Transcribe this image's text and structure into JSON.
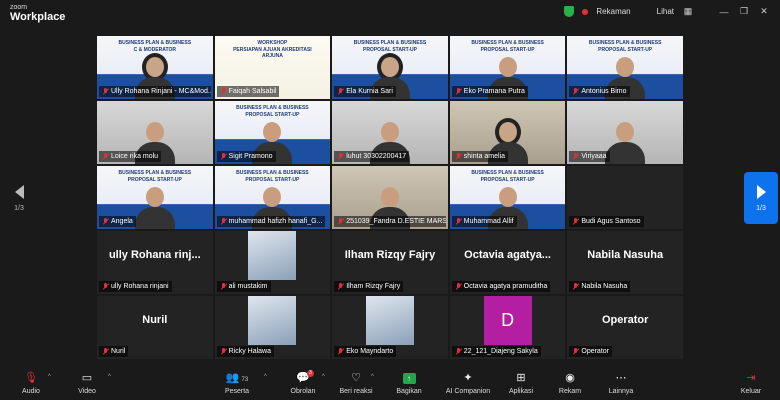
{
  "app": {
    "brand_small": "zoom",
    "brand": "Workplace"
  },
  "titlebar": {
    "recording": "Rekaman",
    "view": "Lihat"
  },
  "nav": {
    "page_left": "1/3",
    "page_right": "1/3"
  },
  "rows": [
    [
      {
        "name": "Ully Rohana Rinjani - MC&Mod...",
        "bg": "slide",
        "kind": "hijab",
        "slide_text": "BUSINESS PLAN & BUSINESS\nC & MODERATOR",
        "active": true
      },
      {
        "name": "Faiqah Salsabil",
        "bg": "slide2",
        "kind": "none",
        "slide_text": "WORKSHOP\nPERSIAPAN AJUAN AKREDITASI\nARJUNA"
      },
      {
        "name": "Ela Kurnia Sari",
        "bg": "slide",
        "kind": "hijab",
        "slide_text": "BUSINESS PLAN & BUSINESS\nPROPOSAL START-UP"
      },
      {
        "name": "Eko Pramana Putra",
        "bg": "slide",
        "kind": "person",
        "slide_text": "BUSINESS PLAN & BUSINESS\nPROPOSAL START-UP"
      },
      {
        "name": "Antonius Bimo",
        "bg": "slide",
        "kind": "person",
        "slide_text": "BUSINESS PLAN & BUSINESS\nPROPOSAL START-UP"
      }
    ],
    [
      {
        "name": "Loice rika molu",
        "bg": "room2",
        "kind": "person"
      },
      {
        "name": "Sigit Pramono",
        "bg": "slide",
        "kind": "person",
        "slide_text": "BUSINESS PLAN & BUSINESS\nPROPOSAL START-UP"
      },
      {
        "name": "luhut 30302200417",
        "bg": "room2",
        "kind": "person"
      },
      {
        "name": "shinta amelia",
        "bg": "room",
        "kind": "hijab"
      },
      {
        "name": "Viriyaaa",
        "bg": "room2",
        "kind": "person"
      }
    ],
    [
      {
        "name": "Angela",
        "bg": "slide",
        "kind": "person",
        "slide_text": "BUSINESS PLAN & BUSINESS\nPROPOSAL START-UP"
      },
      {
        "name": "muhammad hafizh hanafi_G...",
        "bg": "slide",
        "kind": "person",
        "slide_text": "BUSINESS PLAN & BUSINESS\nPROPOSAL START-UP"
      },
      {
        "name": "251039_Fandra D.ESTIE MARS",
        "bg": "room",
        "kind": "person"
      },
      {
        "name": "Muhammad Allif",
        "bg": "slide",
        "kind": "person",
        "slide_text": "BUSINESS PLAN & BUSINESS\nPROPOSAL START-UP"
      },
      {
        "name": "Budi Agus Santoso",
        "bg": "dark",
        "kind": "none"
      }
    ],
    [
      {
        "name": "ully Rohana rinjani",
        "bg": "dark",
        "kind": "text",
        "big": "ully Rohana rinj..."
      },
      {
        "name": "ali mustakim",
        "bg": "dark",
        "kind": "thumb"
      },
      {
        "name": "Ilham Rizqy Fajry",
        "bg": "dark",
        "kind": "text",
        "big": "Ilham Rizqy Fajry"
      },
      {
        "name": "Octavia agatya pramuditha",
        "bg": "dark",
        "kind": "text",
        "big": "Octavia agatya..."
      },
      {
        "name": "Nabila Nasuha",
        "bg": "dark",
        "kind": "text",
        "big": "Nabila Nasuha"
      }
    ],
    [
      {
        "name": "Nuril",
        "bg": "dark",
        "kind": "text",
        "big": "Nuril"
      },
      {
        "name": "Ricky Halawa",
        "bg": "dark",
        "kind": "thumb"
      },
      {
        "name": "Eko Mayndarto",
        "bg": "dark",
        "kind": "thumb"
      },
      {
        "name": "22_121_Diajeng Sakyla",
        "bg": "dark",
        "kind": "avatar",
        "initial": "D"
      },
      {
        "name": "Operator",
        "bg": "dark",
        "kind": "text",
        "big": "Operator"
      }
    ]
  ],
  "toolbar": {
    "audio": "Audio",
    "video": "Video",
    "participants": "Peserta",
    "participants_count": "73",
    "chat": "Obrolan",
    "chat_badge": "3",
    "reactions": "Beri reaksi",
    "share": "Bagikan",
    "ai": "AI Companion",
    "apps": "Aplikasi",
    "record": "Rekam",
    "more": "Lainnya",
    "leave": "Keluar"
  },
  "colors": {
    "accent": "#0e72ed",
    "share": "#1fa74a",
    "danger": "#e0303a",
    "active_border": "#2ecc71"
  }
}
